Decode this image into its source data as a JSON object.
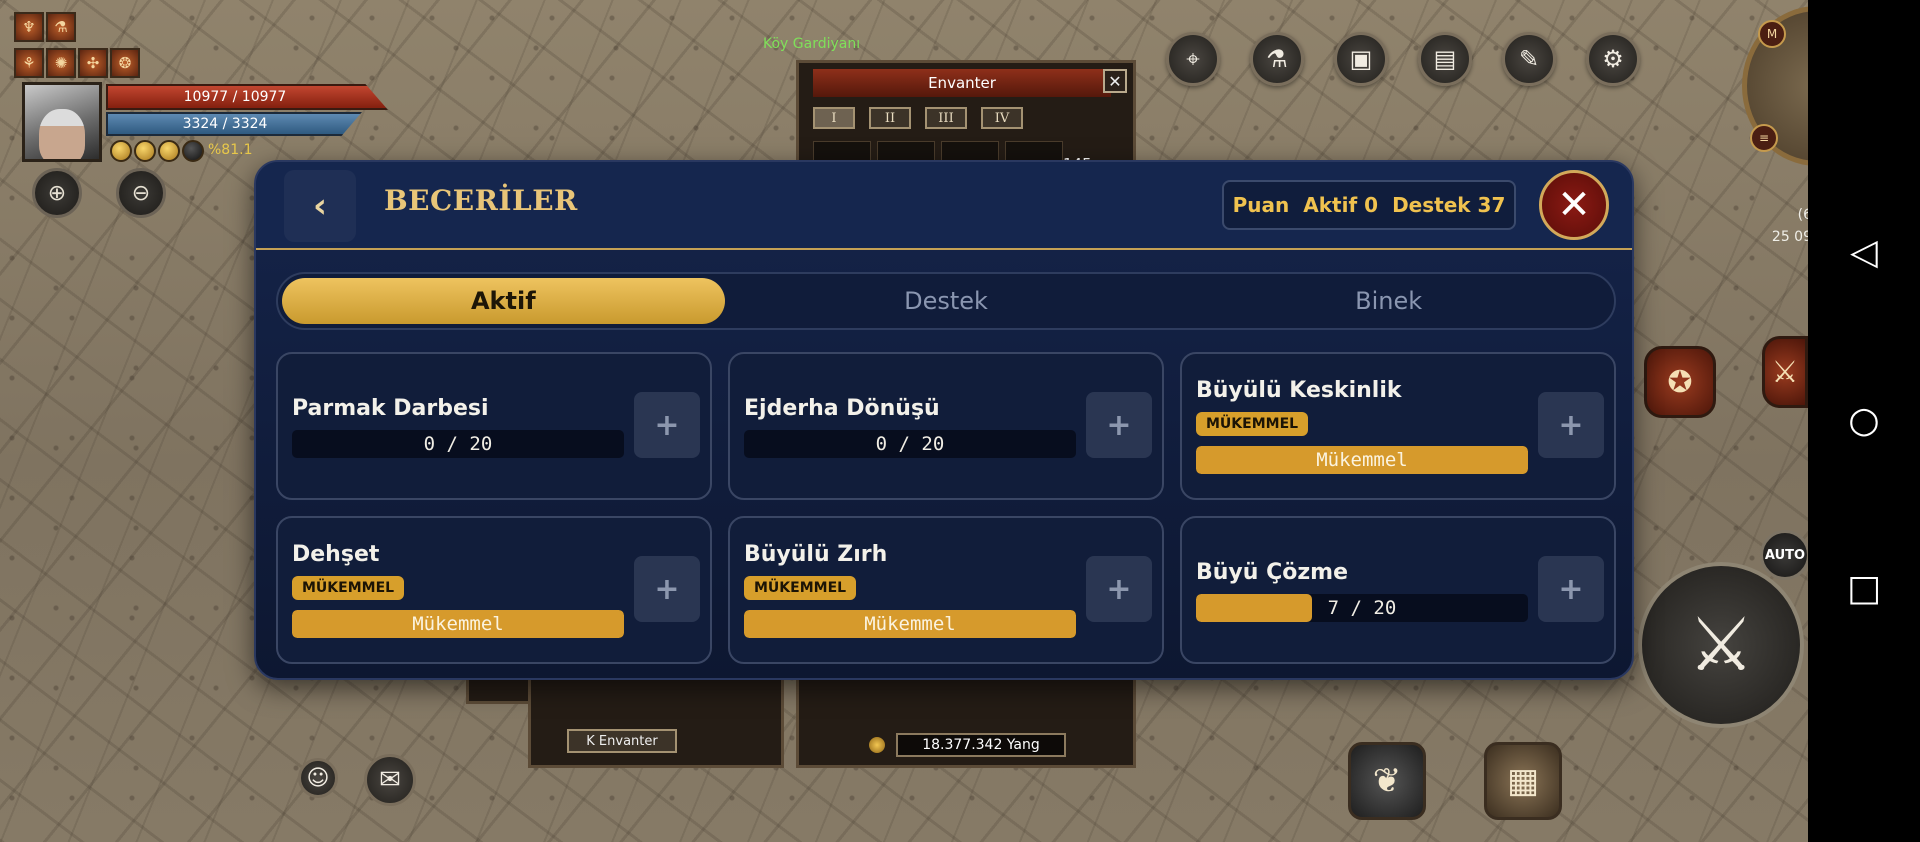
{
  "hud": {
    "hp": "10977 / 10977",
    "mp": "3324 / 3324",
    "exp": "%81.1",
    "npc_name": "Köy Gardiyanı"
  },
  "inventory": {
    "title": "Envanter",
    "tabs": [
      "I",
      "II",
      "III",
      "IV"
    ],
    "level_label": "145",
    "yang": "18.377.342 Yang",
    "k_button": "K Envanter"
  },
  "right_hud": {
    "coord_line1": "(6",
    "coord_line2": "25 09",
    "auto_label": "AUTO"
  },
  "skills_panel": {
    "title": "BECERİLER",
    "points": {
      "label": "Puan",
      "active": "Aktif 0",
      "support": "Destek 37"
    },
    "tabs": [
      {
        "label": "Aktif",
        "active": true
      },
      {
        "label": "Destek",
        "active": false
      },
      {
        "label": "Binek",
        "active": false
      }
    ],
    "skills": [
      {
        "name": "Parmak Darbesi",
        "badge": "",
        "bar_text": "0 / 20",
        "level": 0,
        "max": 20
      },
      {
        "name": "Ejderha Dönüşü",
        "badge": "",
        "bar_text": "0 / 20",
        "level": 0,
        "max": 20
      },
      {
        "name": "Büyülü Keskinlik",
        "badge": "MÜKEMMEL",
        "bar_text": "Mükemmel",
        "level": 20,
        "max": 20
      },
      {
        "name": "Dehşet",
        "badge": "MÜKEMMEL",
        "bar_text": "Mükemmel",
        "level": 20,
        "max": 20
      },
      {
        "name": "Büyülü Zırh",
        "badge": "MÜKEMMEL",
        "bar_text": "Mükemmel",
        "level": 20,
        "max": 20
      },
      {
        "name": "Büyü Çözme",
        "badge": "",
        "bar_text": "7 / 20",
        "level": 7,
        "max": 20
      }
    ],
    "colors": {
      "accent_gold": "#eec35f",
      "panel_bg": "#15244a",
      "close_red": "#8b1a14"
    }
  }
}
